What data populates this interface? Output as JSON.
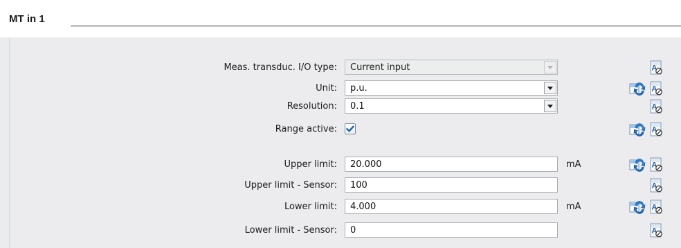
{
  "header": {
    "title": "MT in 1"
  },
  "rows": [
    {
      "label": "Meas. transduc. I/O type:",
      "value": "Current input",
      "kind": "dropdown-disabled",
      "unit": "",
      "sync": false,
      "icon": "text-reference-icon"
    },
    {
      "label": "Unit:",
      "value": "p.u.",
      "kind": "dropdown",
      "unit": "",
      "sync": true,
      "icon": "text-reference-icon"
    },
    {
      "label": "Resolution:",
      "value": "0.1",
      "kind": "dropdown",
      "unit": "",
      "sync": false,
      "icon": "text-reference-icon"
    },
    {
      "label": "Range active:",
      "value": true,
      "kind": "checkbox",
      "unit": "",
      "sync": true,
      "icon": "text-reference-icon"
    },
    {
      "label": "Upper limit:",
      "value": "20.000",
      "kind": "input",
      "unit": "mA",
      "sync": true,
      "icon": "text-reference-icon"
    },
    {
      "label": "Upper limit - Sensor:",
      "value": "100",
      "kind": "input",
      "unit": "",
      "sync": false,
      "icon": "text-reference-icon"
    },
    {
      "label": "Lower limit:",
      "value": "4.000",
      "kind": "input",
      "unit": "mA",
      "sync": true,
      "icon": "text-reference-icon"
    },
    {
      "label": "Lower limit - Sensor:",
      "value": "0",
      "kind": "input",
      "unit": "",
      "sync": false,
      "icon": "text-reference-icon"
    }
  ],
  "colors": {
    "checkbox_accent": "#1f5fa8",
    "sync_icon_blue": "#2a7fd4",
    "background": "#ebecee"
  }
}
